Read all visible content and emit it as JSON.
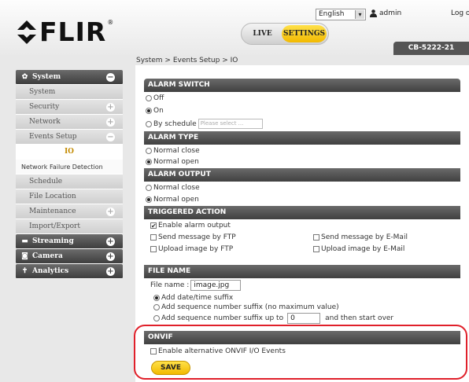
{
  "header": {
    "brand": "FLIR",
    "brand_mark": "®",
    "mode_live": "LIVE",
    "mode_settings": "SETTINGS",
    "language": "English",
    "username": "admin",
    "logout": "Log out",
    "model": "CB-5222-21"
  },
  "breadcrumb": "System > Events Setup > IO",
  "sidebar": {
    "system": "System",
    "system_sub": "System",
    "security": "Security",
    "network": "Network",
    "events_setup": "Events Setup",
    "io": "IO",
    "network_failure": "Network Failure Detection",
    "schedule": "Schedule",
    "file_location": "File Location",
    "maintenance": "Maintenance",
    "import_export": "Import/Export",
    "streaming": "Streaming",
    "camera": "Camera",
    "analytics": "Analytics"
  },
  "alarm_switch": {
    "title": "ALARM SWITCH",
    "off": "Off",
    "on": "On",
    "by_schedule": "By schedule",
    "schedule_placeholder": "Please select ..."
  },
  "alarm_type": {
    "title": "ALARM TYPE",
    "normal_close": "Normal close",
    "normal_open": "Normal open"
  },
  "alarm_output": {
    "title": "ALARM OUTPUT",
    "normal_close": "Normal close",
    "normal_open": "Normal open"
  },
  "triggered_action": {
    "title": "TRIGGERED ACTION",
    "enable_alarm_output": "Enable alarm output",
    "send_ftp": "Send message by FTP",
    "send_email": "Send message by E-Mail",
    "upload_ftp": "Upload image by FTP",
    "upload_email": "Upload image by E-Mail"
  },
  "file_name": {
    "title": "FILE NAME",
    "label": "File name :",
    "value": "image.jpg",
    "add_datetime": "Add date/time suffix",
    "add_seq_nomax": "Add sequence number suffix (no maximum value)",
    "add_seq_upto": "Add sequence number suffix up to",
    "seq_upto_value": "0",
    "then_start_over": "and then start over"
  },
  "onvif": {
    "title": "ONVIF",
    "enable_alt": "Enable alternative ONVIF I/O Events"
  },
  "save_label": "SAVE",
  "colors": {
    "accent": "#f2b900",
    "highlight": "#e0202a",
    "section_bar": "#4a4a4a"
  }
}
